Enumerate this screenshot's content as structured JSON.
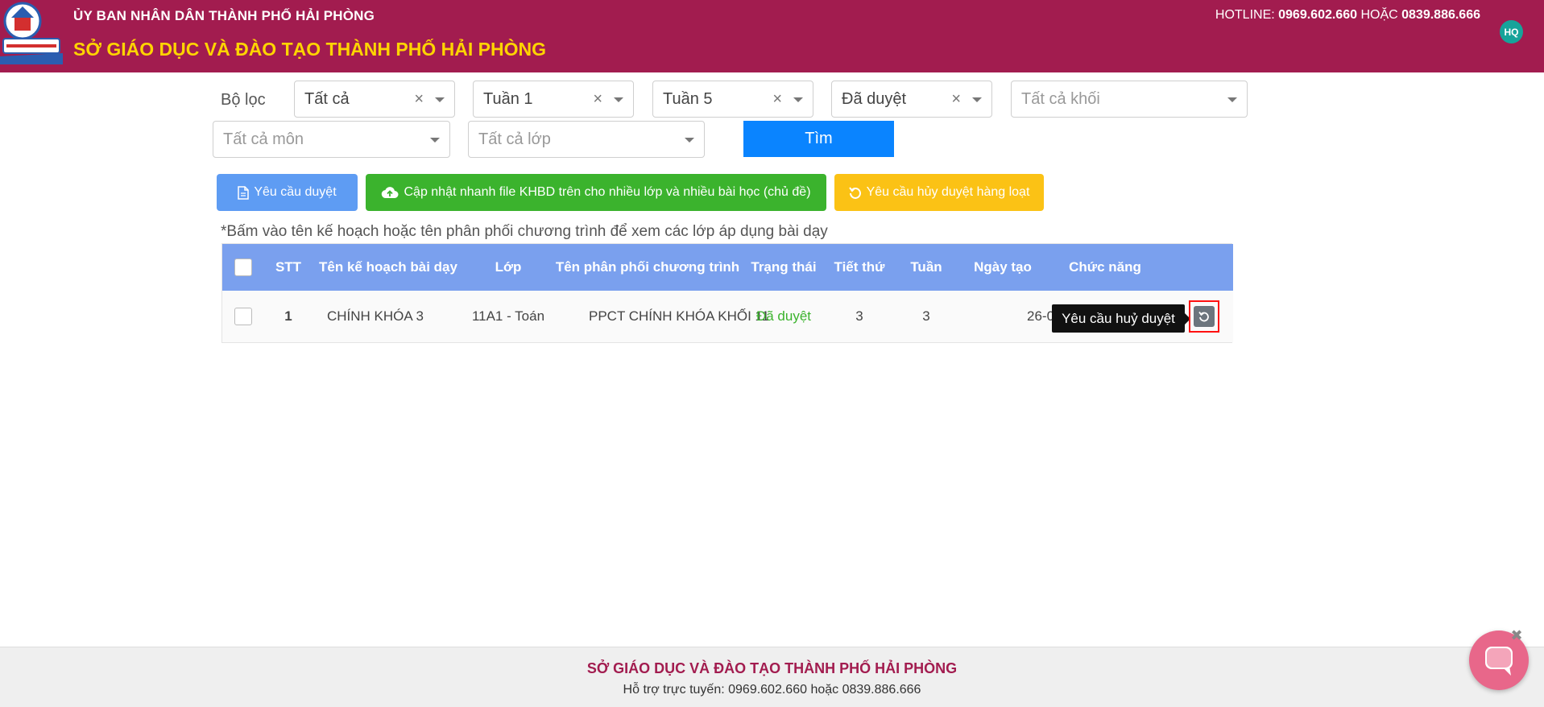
{
  "header": {
    "org": "ỦY BAN NHÂN DÂN THÀNH PHỐ HẢI PHÒNG",
    "title": "SỞ GIÁO DỤC VÀ ĐÀO TẠO THÀNH PHỐ HẢI PHÒNG",
    "hotline_label": "HOTLINE: ",
    "hotline_1": "0969.602.660",
    "hotline_or": " HOẶC ",
    "hotline_2": "0839.886.666",
    "avatar_initials": "HQ",
    "colors": {
      "header_bg": "#a21c4f",
      "title": "#ffd400"
    }
  },
  "filters": {
    "label": "Bộ lọc",
    "all": "Tất cả",
    "week_from": "Tuần 1",
    "week_to": "Tuần 5",
    "status": "Đã duyệt",
    "grade_placeholder": "Tất cả khối",
    "subject_placeholder": "Tất cả môn",
    "class_placeholder": "Tất cả lớp",
    "find_label": "Tìm",
    "clear_symbol": "×"
  },
  "actions": {
    "request_approval": "Yêu cầu duyệt",
    "quick_update": "Cập nhật nhanh file KHBD trên cho nhiều lớp và nhiều bài học (chủ đề)",
    "bulk_cancel_request": "Yêu cầu hủy duyệt hàng loạt",
    "icons": {
      "request_approval": "file-icon",
      "quick_update": "cloud-upload-icon",
      "bulk_cancel_request": "undo-icon"
    }
  },
  "note": "*Bấm vào tên kế hoạch hoặc tên phân phối chương trình để xem các lớp áp dụng bài dạy",
  "table": {
    "columns": [
      "STT",
      "Tên kế hoạch bài dạy",
      "Lớp",
      "Tên phân phối chương trình",
      "Trạng thái",
      "Tiết thứ",
      "Tuần",
      "Ngày tạo",
      "Chức năng"
    ],
    "rows": [
      {
        "stt": "1",
        "plan_name": "CHÍNH KHÓA 3",
        "class": "11A1 - Toán",
        "program": "PPCT CHÍNH KHÓA KHỐI 11",
        "status": "Đã duyệt",
        "lesson": "3",
        "week": "3",
        "created": "26-0"
      }
    ],
    "tooltip": "Yêu cầu huỷ duyệt",
    "colors": {
      "header_bg": "#7aa0ee",
      "status_ok": "#3bb32d"
    }
  },
  "footer": {
    "title": "SỞ GIÁO DỤC VÀ ĐÀO TẠO THÀNH PHỐ HẢI PHÒNG",
    "support": "Hỗ trợ trực tuyến: 0969.602.660 hoặc 0839.886.666"
  },
  "chat": {
    "close_symbol": "✖",
    "icon": "chat-bubble-icon"
  }
}
